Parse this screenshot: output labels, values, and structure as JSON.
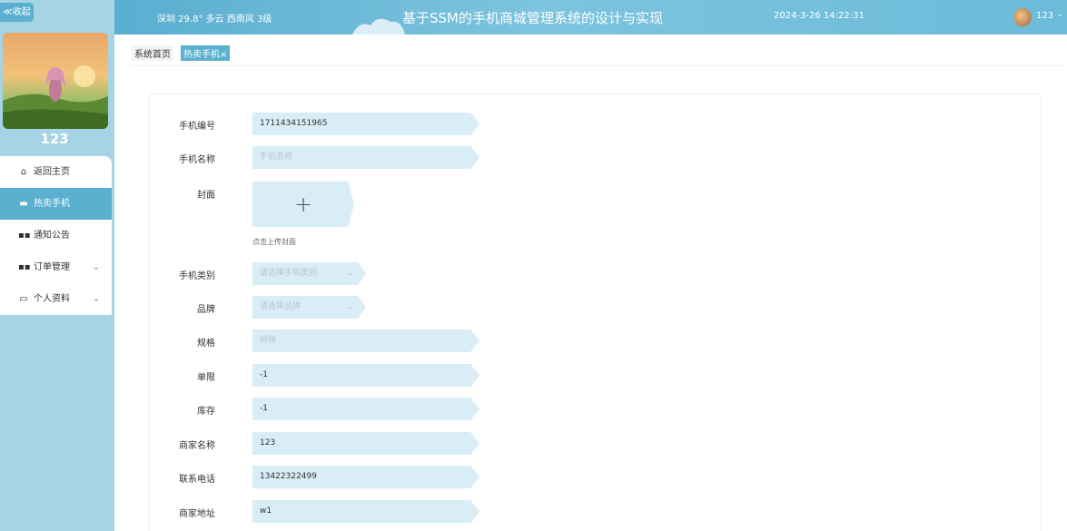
{
  "sidebar": {
    "collapse_label": "≪收起",
    "username": "123",
    "menu": [
      {
        "icon": "home-icon",
        "glyph": "⌂",
        "label": "返回主页",
        "active": false,
        "has_arrow": false
      },
      {
        "icon": "bag-icon",
        "glyph": "▬",
        "label": "热卖手机",
        "active": true,
        "has_arrow": false
      },
      {
        "icon": "grid-icon",
        "glyph": "▪▪",
        "label": "通知公告",
        "active": false,
        "has_arrow": false
      },
      {
        "icon": "grid-icon",
        "glyph": "▪▪",
        "label": "订单管理",
        "active": false,
        "has_arrow": true
      },
      {
        "icon": "profile-icon",
        "glyph": "▭",
        "label": "个人资料",
        "active": false,
        "has_arrow": true
      }
    ]
  },
  "header": {
    "weather": "深圳  29.8°  多云  西南风  3级",
    "title": "基于SSM的手机商城管理系统的设计与实现",
    "datetime": "2024-3-26 14:22:31",
    "user": "123",
    "caret": "⌄"
  },
  "breadcrumb": {
    "home": "系统首页",
    "current": "热卖手机×"
  },
  "form": {
    "phone_no_label": "手机编号",
    "phone_no_value": "1711434151965",
    "phone_name_label": "手机名称",
    "phone_name_placeholder": "手机名称",
    "cover_label": "封面",
    "upload_plus": "+",
    "upload_tip": "点击上传封面",
    "category_label": "手机类别",
    "category_placeholder": "请选择手机类别",
    "brand_label": "品牌",
    "brand_placeholder": "请选择品牌",
    "spec_label": "规格",
    "spec_placeholder": "规格",
    "limit_label": "单限",
    "limit_value": "-1",
    "stock_label": "库存",
    "stock_value": "-1",
    "merchant_label": "商家名称",
    "merchant_value": "123",
    "phone_label": "联系电话",
    "phone_value": "13422322499",
    "address_label": "商家地址",
    "address_value": "w1",
    "select_caret": "⌄"
  },
  "colors": {
    "accent": "#5bb0cf",
    "sidebar_bg": "#a6d4e4",
    "input_bg": "#d8edf5"
  }
}
